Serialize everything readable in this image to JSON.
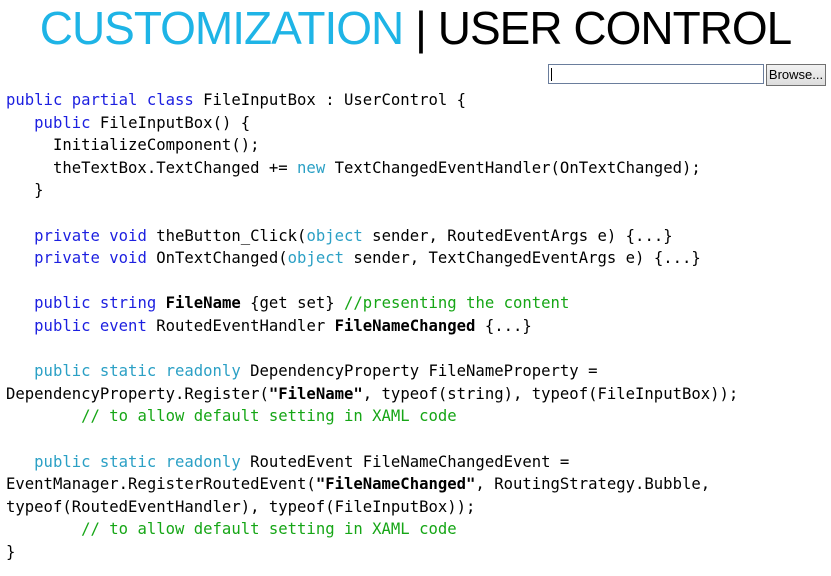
{
  "slide": {
    "title_left": "CUSTOMIZATION",
    "title_sep": "|",
    "title_right": "USER CONTROL"
  },
  "file_input": {
    "text_value": "",
    "browse_label": "Browse..."
  },
  "code": {
    "l1": {
      "a": "public partial class",
      "b": " FileInputBox : UserControl {"
    },
    "l2": {
      "ind": "   ",
      "a": "public",
      "b": " FileInputBox() {"
    },
    "l3": {
      "text": "     InitializeComponent();"
    },
    "l4": {
      "a": "     theTextBox.TextChanged += ",
      "kw": "new",
      "b": " TextChangedEventHandler(OnTextChanged);"
    },
    "l5": {
      "text": "   }"
    },
    "l6": {
      "text": ""
    },
    "l7": {
      "ind": "   ",
      "a": "private void",
      "b": " theButton_Click(",
      "ty": "object",
      "c": " sender, RoutedEventArgs e) {...}"
    },
    "l8": {
      "ind": "   ",
      "a": "private void",
      "b": " OnTextChanged(",
      "ty": "object",
      "c": " sender, TextChangedEventArgs e) {...}"
    },
    "l9": {
      "text": ""
    },
    "l10": {
      "ind": "   ",
      "a": "public string",
      "sp": " ",
      "bold": "FileName",
      "b": " {get set} ",
      "cm": "//presenting the content"
    },
    "l11": {
      "ind": "   ",
      "a": "public event",
      "b": " RoutedEventHandler ",
      "bold": "FileNameChanged",
      "c": " {...}"
    },
    "l12": {
      "text": ""
    },
    "l13": {
      "ind": "   ",
      "a": "public static readonly",
      "b": " DependencyProperty FileNameProperty ="
    },
    "l14": {
      "a": "DependencyProperty.Register(",
      "bold": "\"FileName\"",
      "b": ", typeof(string), typeof(FileInputBox));"
    },
    "l15": {
      "ind": "        ",
      "cm": "// to allow default setting in XAML code"
    },
    "l16": {
      "text": ""
    },
    "l17": {
      "ind": "   ",
      "a": "public static readonly",
      "b": " RoutedEvent FileNameChangedEvent ="
    },
    "l18": {
      "a": "EventManager.RegisterRoutedEvent(",
      "bold": "\"FileNameChanged\"",
      "b": ", RoutingStrategy.Bubble,"
    },
    "l19": {
      "text": "typeof(RoutedEventHandler), typeof(FileInputBox));"
    },
    "l20": {
      "ind": "        ",
      "cm": "// to allow default setting in XAML code"
    },
    "l21": {
      "text": "}"
    }
  }
}
